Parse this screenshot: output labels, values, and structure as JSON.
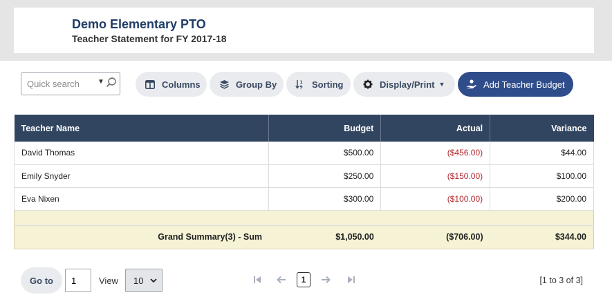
{
  "header": {
    "org_name": "Demo Elementary PTO",
    "report_title": "Teacher Statement for FY 2017-18"
  },
  "toolbar": {
    "search_placeholder": "Quick search",
    "columns_label": "Columns",
    "group_by_label": "Group By",
    "sorting_label": "Sorting",
    "display_print_label": "Display/Print",
    "add_label": "Add Teacher Budget"
  },
  "table": {
    "columns": [
      "Teacher Name",
      "Budget",
      "Actual",
      "Variance"
    ],
    "rows": [
      {
        "teacher": "David Thomas",
        "budget": "$500.00",
        "actual": "($456.00)",
        "variance": "$44.00"
      },
      {
        "teacher": "Emily Snyder",
        "budget": "$250.00",
        "actual": "($150.00)",
        "variance": "$100.00"
      },
      {
        "teacher": "Eva Nixen",
        "budget": "$300.00",
        "actual": "($100.00)",
        "variance": "$200.00"
      }
    ],
    "summary": {
      "label": "Grand Summary(3) - Sum",
      "budget": "$1,050.00",
      "actual": "($706.00)",
      "variance": "$344.00"
    }
  },
  "pager": {
    "goto_label": "Go to",
    "page_value": "1",
    "view_label": "View",
    "page_size": "10",
    "current_page": "1",
    "range": "[1 to 3 of 3]"
  },
  "colors": {
    "header_bg": "#314560",
    "accent": "#2f4d8a",
    "negative": "#b3262b",
    "summary_bg": "#f5f2d6"
  }
}
